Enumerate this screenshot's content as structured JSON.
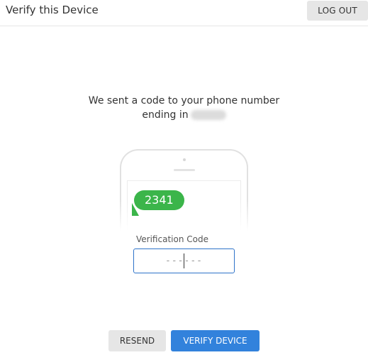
{
  "header": {
    "title": "Verify this Device",
    "logout_label": "LOG OUT"
  },
  "message": {
    "line1": "We sent a code to your phone number",
    "line2": "ending in"
  },
  "sms": {
    "code": "2341"
  },
  "verification": {
    "label": "Verification Code",
    "value": "",
    "placeholder": "------"
  },
  "actions": {
    "resend_label": "RESEND",
    "verify_label": "VERIFY DEVICE"
  },
  "colors": {
    "primary": "#3282dc",
    "sms_bubble": "#3bb54a",
    "secondary_button": "#e6e6e6",
    "input_border": "#2e73c9"
  },
  "icons": {
    "phone": "phone-illustration"
  }
}
